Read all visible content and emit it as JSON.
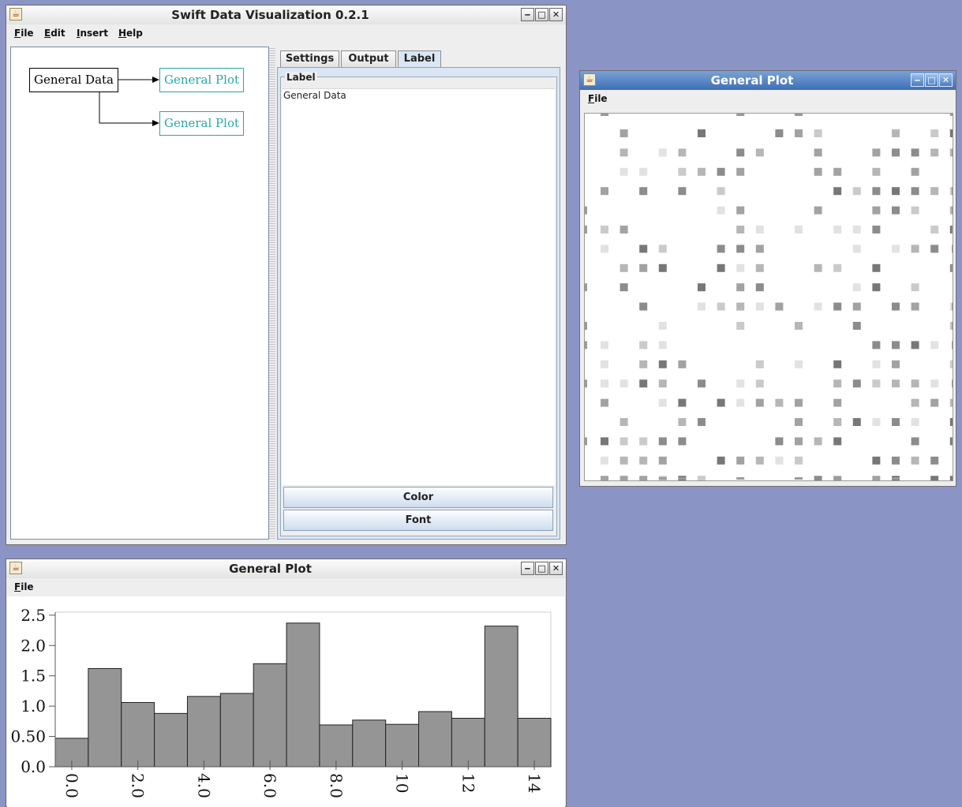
{
  "main_window": {
    "title": "Swift Data Visualization 0.2.1",
    "menus": [
      "File",
      "Edit",
      "Insert",
      "Help"
    ],
    "graph": {
      "data_node": "General Data",
      "plot_nodes": [
        "General Plot",
        "General Plot"
      ]
    },
    "tabs": [
      "Settings",
      "Output",
      "Label"
    ],
    "selected_tab": "Label",
    "label_panel": {
      "group_title": "Label",
      "text_value": "General Data"
    },
    "buttons": {
      "color": "Color",
      "font": "Font"
    }
  },
  "grid_plot_window": {
    "title": "General Plot",
    "menus": [
      "File"
    ]
  },
  "histogram_window": {
    "title": "General Plot",
    "menus": [
      "File"
    ]
  },
  "window_buttons": {
    "minimize": "‒",
    "maximize": "□",
    "close": "✕"
  },
  "colors": {
    "desktop": "#8a94c5",
    "active_title": "#4f80c2",
    "plot_node": "#29a7a7",
    "bar_fill": "#959595"
  },
  "chart_data": {
    "type": "bar",
    "bin_starts": [
      0,
      1,
      2,
      3,
      4,
      5,
      6,
      7,
      8,
      9,
      10,
      11,
      12,
      13,
      14
    ],
    "values": [
      0.47,
      1.62,
      1.06,
      0.88,
      1.16,
      1.21,
      1.7,
      2.37,
      0.69,
      0.77,
      0.7,
      0.91,
      0.8,
      2.32,
      0.8
    ],
    "xlim": [
      -0.5,
      14.5
    ],
    "ylim": [
      0,
      2.55
    ],
    "yticks": [
      "0.0",
      "0.50",
      "1.0",
      "1.5",
      "2.0",
      "2.5"
    ],
    "ytick_values": [
      0,
      0.5,
      1.0,
      1.5,
      2.0,
      2.5
    ],
    "xticks": [
      "0.0",
      "2.0",
      "4.0",
      "6.0",
      "8.0",
      "10",
      "12",
      "14"
    ],
    "xtick_values": [
      0,
      2,
      4,
      6,
      8,
      10,
      12,
      14
    ],
    "xlabel": "",
    "ylabel": "",
    "title": ""
  }
}
